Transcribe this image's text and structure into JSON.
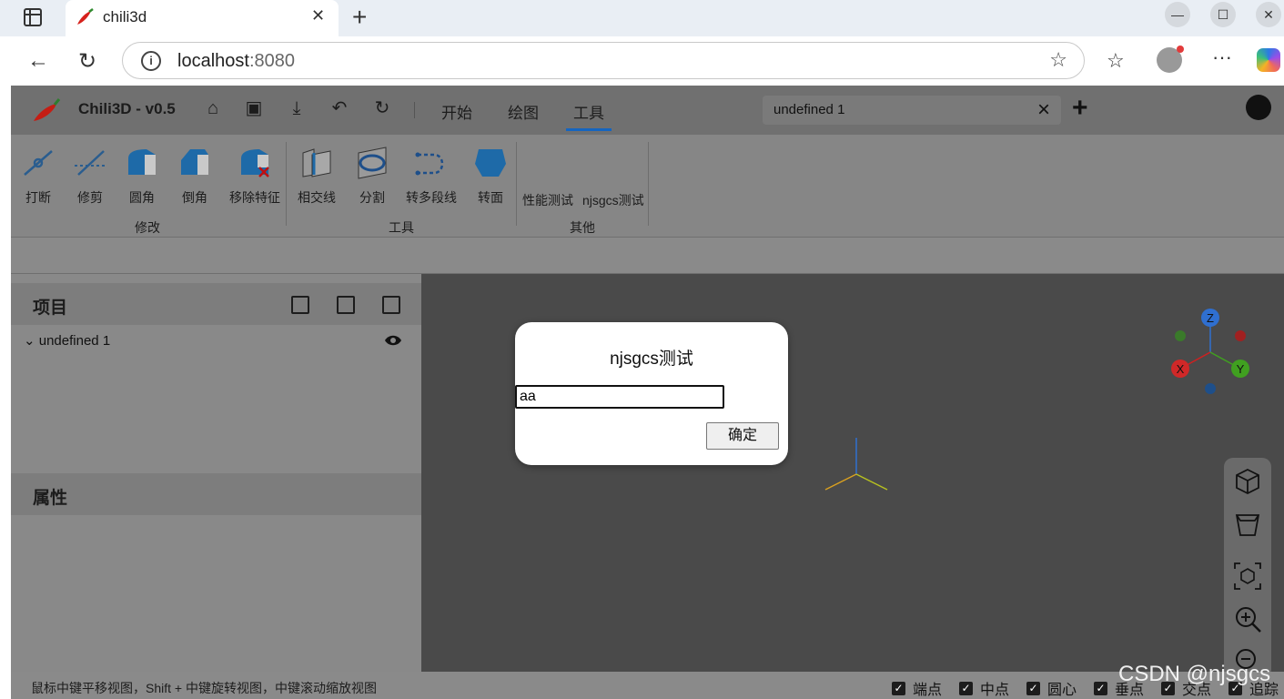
{
  "browser": {
    "tab_title": "chili3d",
    "url_host": "localhost",
    "url_port": ":8080",
    "window_controls": [
      "minimize",
      "maximize",
      "close"
    ]
  },
  "app": {
    "title": "Chili3D - v0.5",
    "menu_tabs": [
      {
        "label": "开始",
        "active": false
      },
      {
        "label": "绘图",
        "active": false
      },
      {
        "label": "工具",
        "active": true
      }
    ],
    "document_tab": "undefined 1"
  },
  "ribbon": {
    "groups": [
      {
        "label": "修改",
        "items": [
          "打断",
          "修剪",
          "圆角",
          "倒角",
          "移除特征"
        ]
      },
      {
        "label": "工具",
        "items": [
          "相交线",
          "分割",
          "转多段线",
          "转面"
        ]
      },
      {
        "label": "其他",
        "items": [
          "性能测试",
          "njsgcs测试"
        ]
      }
    ]
  },
  "project_panel": {
    "title": "项目",
    "tree_item": "undefined 1"
  },
  "properties_panel": {
    "title": "属性"
  },
  "status_bar": {
    "message": "鼠标中键平移视图，Shift + 中键旋转视图，中键滚动缩放视图",
    "snaps": [
      "端点",
      "中点",
      "圆心",
      "垂点",
      "交点",
      "追踪"
    ]
  },
  "dialog": {
    "title": "njsgcs测试",
    "input_value": "aa",
    "ok_label": "确定"
  },
  "gizmo": {
    "axes": [
      "X",
      "Y",
      "Z"
    ]
  },
  "watermark": "CSDN @njsgcs"
}
